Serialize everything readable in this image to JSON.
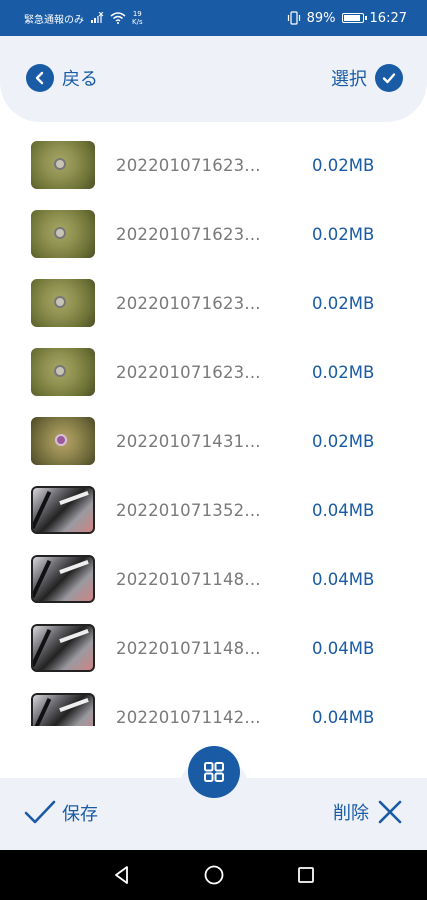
{
  "status_bar": {
    "carrier_text": "緊急通報のみ",
    "speed_value": "19",
    "speed_unit": "K/s",
    "battery": "89%",
    "time": "16:27",
    "battery_level": 0.89
  },
  "header": {
    "back_label": "戻る",
    "select_label": "選択"
  },
  "files": [
    {
      "name": "202201071623...",
      "size": "0.02MB",
      "thumb": "green"
    },
    {
      "name": "202201071623...",
      "size": "0.02MB",
      "thumb": "green"
    },
    {
      "name": "202201071623...",
      "size": "0.02MB",
      "thumb": "green"
    },
    {
      "name": "202201071623...",
      "size": "0.02MB",
      "thumb": "green"
    },
    {
      "name": "202201071431...",
      "size": "0.02MB",
      "thumb": "purple"
    },
    {
      "name": "202201071352...",
      "size": "0.04MB",
      "thumb": "bw"
    },
    {
      "name": "202201071148...",
      "size": "0.04MB",
      "thumb": "bw"
    },
    {
      "name": "202201071148...",
      "size": "0.04MB",
      "thumb": "bw"
    },
    {
      "name": "202201071142...",
      "size": "0.04MB",
      "thumb": "bw"
    }
  ],
  "bottom": {
    "save_label": "保存",
    "delete_label": "削除"
  },
  "colors": {
    "accent": "#1a5ba6",
    "panel": "#eef2f8",
    "filename": "#7a7a7a"
  },
  "icons": {
    "back": "chevron-left-icon",
    "select": "checkmark-icon",
    "grid": "grid-icon",
    "save": "checkmark-icon",
    "delete": "close-icon"
  }
}
